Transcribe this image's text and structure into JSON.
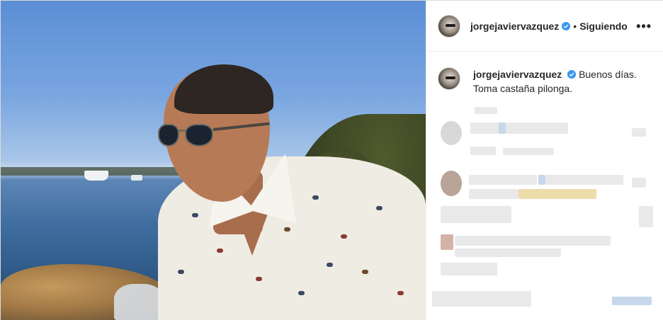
{
  "post": {
    "author": {
      "username": "jorgejaviervazquez",
      "verified": true
    },
    "follow_status": "Siguiendo",
    "more_glyph": "•••",
    "separator": "•",
    "caption": {
      "username": "jorgejaviervazquez",
      "text_line1": "Buenos días.",
      "text_line2": "Toma castaña pilonga."
    }
  },
  "colors": {
    "verified_blue": "#3897f0",
    "text": "#262626",
    "border": "#dbdbdb"
  },
  "icons": {
    "more_options": "ellipsis-icon",
    "verified_badge": "verified-badge-icon"
  }
}
